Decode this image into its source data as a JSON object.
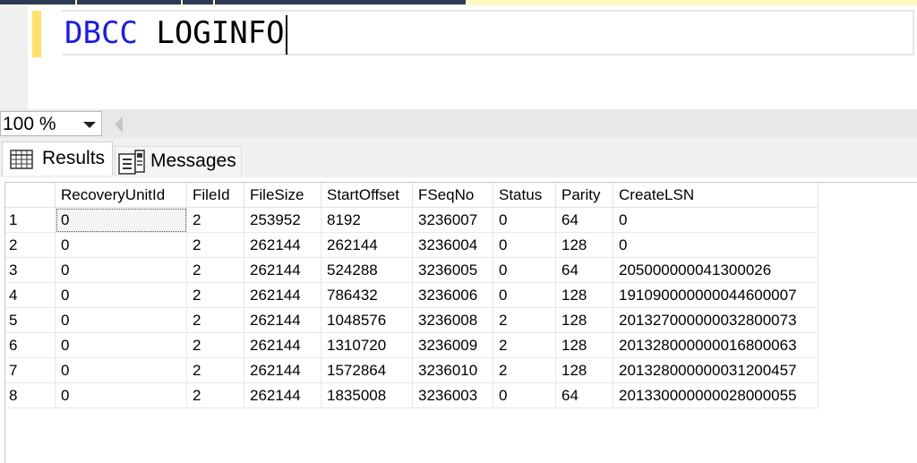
{
  "editor": {
    "keyword": "DBCC",
    "command": " LOGINFO"
  },
  "zoom": {
    "value": "100 %"
  },
  "tabs": [
    {
      "label": "Results",
      "icon": "grid-icon"
    },
    {
      "label": "Messages",
      "icon": "messages-icon"
    }
  ],
  "grid": {
    "columns": [
      "RecoveryUnitId",
      "FileId",
      "FileSize",
      "StartOffset",
      "FSeqNo",
      "Status",
      "Parity",
      "CreateLSN"
    ],
    "rows": [
      {
        "n": "1",
        "cells": [
          "0",
          "2",
          "253952",
          "8192",
          "3236007",
          "0",
          "64",
          "0"
        ]
      },
      {
        "n": "2",
        "cells": [
          "0",
          "2",
          "262144",
          "262144",
          "3236004",
          "0",
          "128",
          "0"
        ]
      },
      {
        "n": "3",
        "cells": [
          "0",
          "2",
          "262144",
          "524288",
          "3236005",
          "0",
          "64",
          "205000000041300026"
        ]
      },
      {
        "n": "4",
        "cells": [
          "0",
          "2",
          "262144",
          "786432",
          "3236006",
          "0",
          "128",
          "191090000000044600007"
        ]
      },
      {
        "n": "5",
        "cells": [
          "0",
          "2",
          "262144",
          "1048576",
          "3236008",
          "2",
          "128",
          "201327000000032800073"
        ]
      },
      {
        "n": "6",
        "cells": [
          "0",
          "2",
          "262144",
          "1310720",
          "3236009",
          "2",
          "128",
          "201328000000016800063"
        ]
      },
      {
        "n": "7",
        "cells": [
          "0",
          "2",
          "262144",
          "1572864",
          "3236010",
          "2",
          "128",
          "201328000000031200457"
        ]
      },
      {
        "n": "8",
        "cells": [
          "0",
          "2",
          "262144",
          "1835008",
          "3236003",
          "0",
          "64",
          "201330000000028000055"
        ]
      }
    ]
  },
  "colors": {
    "keyword": "#1a1af0",
    "change_bar": "#ffe168"
  }
}
